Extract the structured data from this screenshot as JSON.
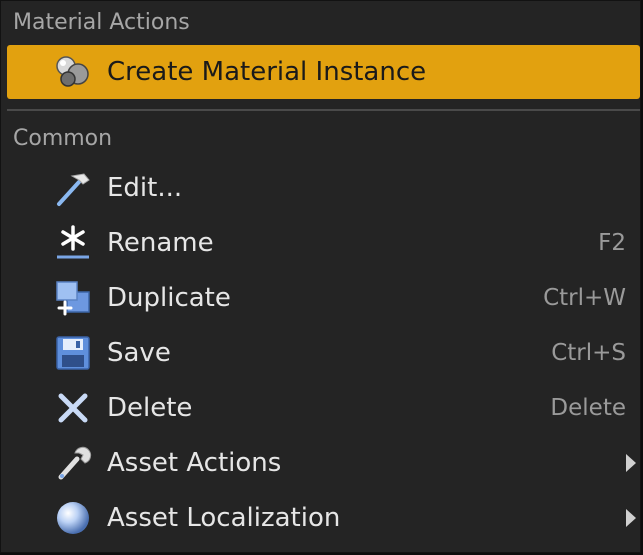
{
  "menu": {
    "sections": [
      {
        "header": "Material Actions",
        "items": [
          {
            "label": "Create Material Instance",
            "icon": "material-sphere-icon"
          }
        ]
      },
      {
        "header": "Common",
        "items": [
          {
            "label": "Edit...",
            "icon": "hammer-icon",
            "shortcut": ""
          },
          {
            "label": "Rename",
            "icon": "asterisk-icon",
            "shortcut": "F2"
          },
          {
            "label": "Duplicate",
            "icon": "duplicate-icon",
            "shortcut": "Ctrl+W"
          },
          {
            "label": "Save",
            "icon": "floppy-disk-icon",
            "shortcut": "Ctrl+S"
          },
          {
            "label": "Delete",
            "icon": "x-icon",
            "shortcut": "Delete"
          },
          {
            "label": "Asset Actions",
            "icon": "wrench-icon",
            "submenu": true
          },
          {
            "label": "Asset Localization",
            "icon": "globe-icon",
            "submenu": true
          }
        ]
      }
    ]
  },
  "colors": {
    "background": "#242424",
    "highlight": "#e2a10f",
    "text": "#e6e6e6",
    "shortcut_text": "#9a9a9a",
    "header_text": "#a6a6a6"
  }
}
